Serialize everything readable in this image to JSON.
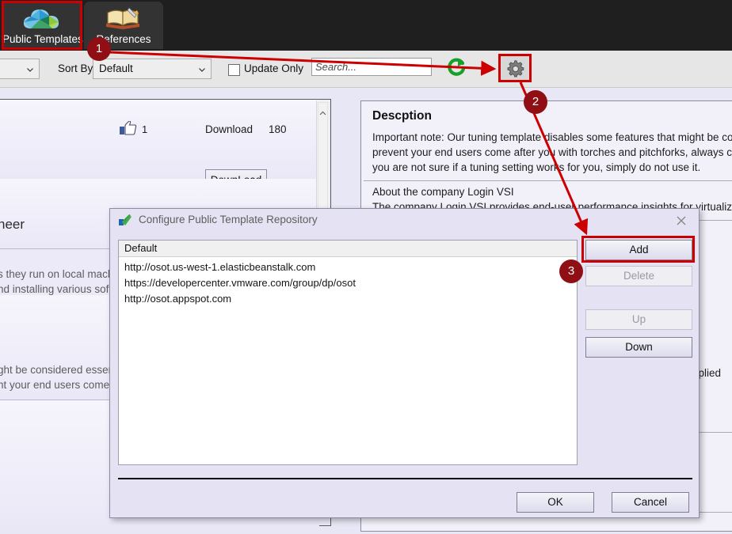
{
  "app": {
    "ribbon_tabs": [
      {
        "label": "Public Templates",
        "icon": "cloud-templates-icon",
        "selected": true
      },
      {
        "label": "References",
        "icon": "book-references-icon",
        "selected": false
      }
    ]
  },
  "toolbar": {
    "filter_combo_value": "",
    "sort_by_label": "Sort By",
    "sort_by_value": "Default",
    "update_only_label": "Update Only",
    "update_only_checked": false,
    "search_placeholder": "Search...",
    "refresh_icon": "refresh-icon",
    "settings_icon": "gear-icon"
  },
  "left_panel": {
    "cards": [
      {
        "like_icon": "thumbs-up-icon",
        "like_count": "1",
        "download_label": "Download",
        "download_count": "180",
        "download_button": "DownLoad"
      }
    ],
    "background_rows": [
      {
        "title": "neer"
      },
      {
        "line1": "s they run on local machin",
        "line2": "nd installing various softw"
      },
      {
        "line1": "ght be considered essentia",
        "line2": "nt your end users come af"
      }
    ],
    "scrollbar": "vertical-scrollbar"
  },
  "description_panel": {
    "title": "Descption",
    "lines": [
      "Important note: Our tuning template disables some features that might be considered",
      "prevent your end users come after you with torches and pitchforks, always consider th",
      "you are not sure if a tuning setting works for you, simply do not use it.",
      "",
      "About the company Login VSI",
      "The company Login VSI provides end-user performance insights for virtualized desktop"
    ],
    "side_text": "pplied"
  },
  "dialog": {
    "title": "Configure Public Template Repository",
    "icon": "app-checkmark-icon",
    "close_icon": "close-icon",
    "list_header": "Default",
    "list_items": [
      "http://osot.us-west-1.elasticbeanstalk.com",
      "https://developercenter.vmware.com/group/dp/osot",
      "http://osot.appspot.com"
    ],
    "buttons": {
      "add": "Add",
      "delete": "Delete",
      "up": "Up",
      "down": "Down",
      "ok": "OK",
      "cancel": "Cancel"
    },
    "disabled_buttons": [
      "Delete",
      "Up"
    ]
  },
  "annotations": {
    "accent_color": "#cc0000",
    "badge_color": "#8f0f14",
    "steps": [
      {
        "number": "1",
        "target": "Public Templates tab"
      },
      {
        "number": "2",
        "target": "gear settings button"
      },
      {
        "number": "3",
        "target": "Add button"
      }
    ]
  }
}
